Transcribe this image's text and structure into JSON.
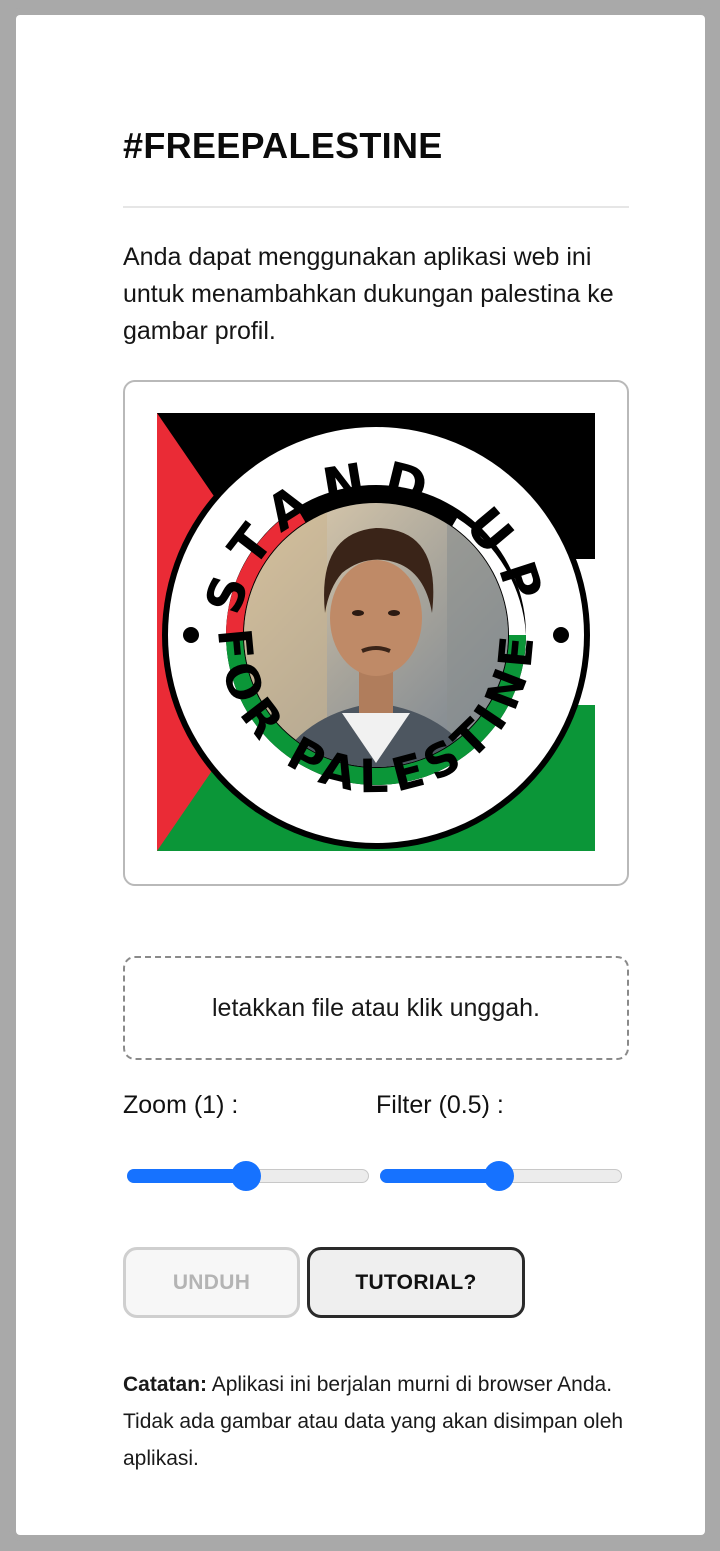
{
  "page": {
    "title": "#FREEPALESTINE",
    "intro": "Anda dapat menggunakan aplikasi web ini untuk menambahkan dukungan palestina ke gambar profil."
  },
  "preview": {
    "badge_top_text": "STAND UP",
    "badge_bottom_text": "FOR PALESTINE",
    "colors": {
      "red": "#ea2b36",
      "black": "#000000",
      "green": "#0b9638",
      "white": "#ffffff"
    }
  },
  "upload": {
    "label": "letakkan file atau klik unggah."
  },
  "controls": {
    "zoom_label": "Zoom (1) :",
    "zoom_value": 0.5,
    "filter_label": "Filter (0.5) :",
    "filter_value": 0.5
  },
  "buttons": {
    "download": "UNDUH",
    "tutorial": "TUTORIAL?"
  },
  "note": {
    "bold": "Catatan:",
    "text": " Aplikasi ini berjalan murni di browser Anda. Tidak ada gambar atau data yang akan disimpan oleh aplikasi."
  },
  "accent_color": "#1672ff"
}
